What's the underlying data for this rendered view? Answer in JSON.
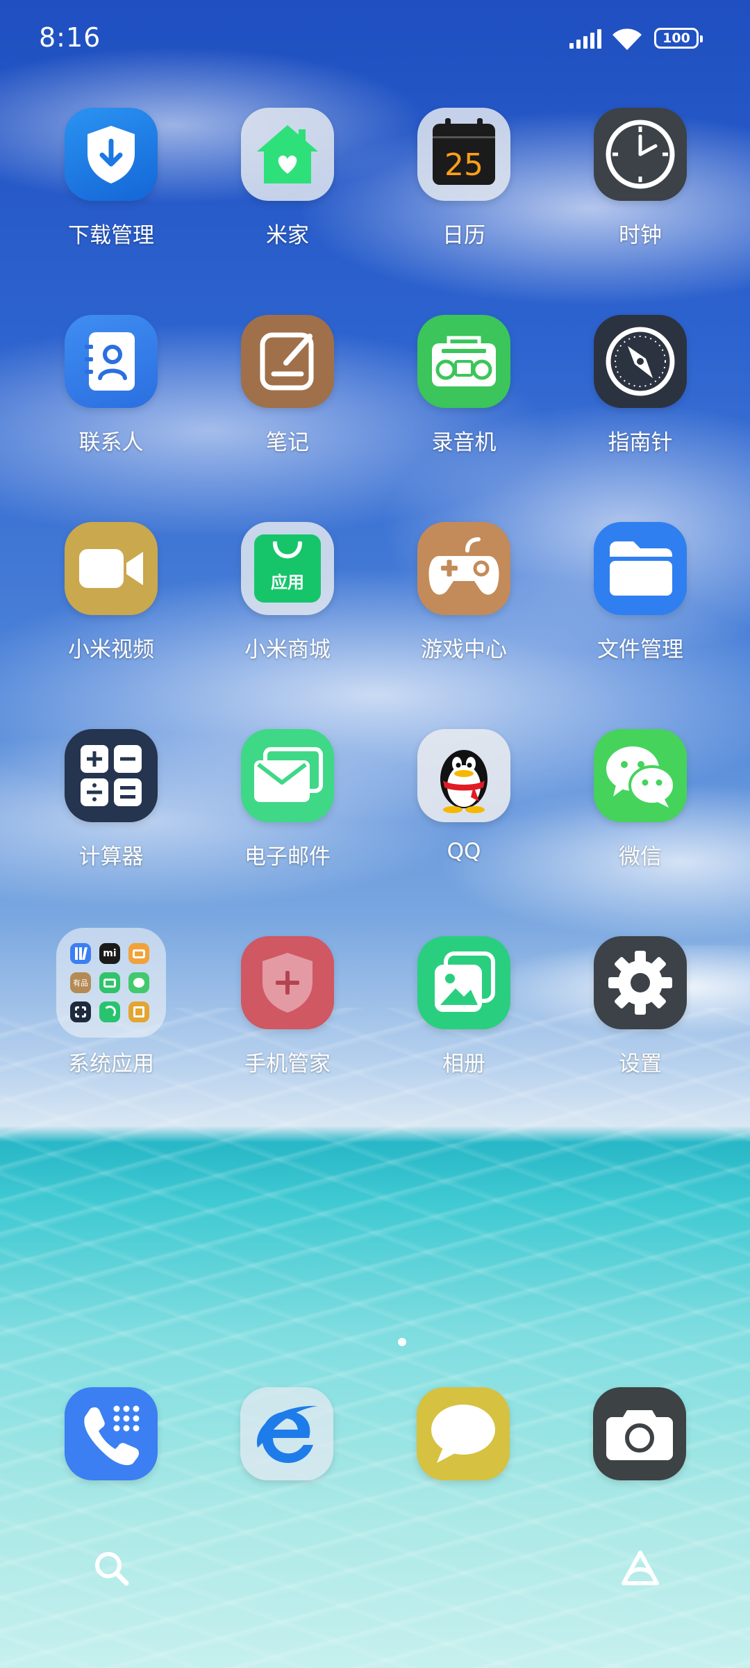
{
  "status_bar": {
    "time": "8:16",
    "battery": "100",
    "icons": [
      "signal-icon",
      "wifi-icon",
      "battery-icon"
    ]
  },
  "apps": {
    "download_manager": "下载管理",
    "mijia": "米家",
    "calendar": "日历",
    "calendar_day": "25",
    "clock": "时钟",
    "contacts": "联系人",
    "notes": "笔记",
    "recorder": "录音机",
    "compass": "指南针",
    "mi_video": "小米视频",
    "mi_store": "小米商城",
    "mi_store_icon_text": "应用",
    "game_center": "游戏中心",
    "file_manager": "文件管理",
    "calculator": "计算器",
    "email": "电子邮件",
    "qq": "QQ",
    "wechat": "微信",
    "system_apps_folder": "系统应用",
    "security": "手机管家",
    "gallery": "相册",
    "settings": "设置"
  },
  "folder_mini_icons": {
    "mi_logo": "mi",
    "youpin": "有品"
  },
  "dock": [
    "phone-icon",
    "browser-icon",
    "messages-icon",
    "camera-icon"
  ],
  "bottom_bar": [
    "search-icon",
    "assistant-icon"
  ],
  "colors": {
    "download_blue": "#1e7fe6",
    "mijia_green": "#2ee07a",
    "notes_brown": "#a0704a",
    "recorder_green": "#3bc55a",
    "video_gold": "#c9a84e",
    "store_green": "#16c56a",
    "game_orange": "#c38b5a",
    "files_blue": "#2f7ff0",
    "calc_dark": "#25344f",
    "mail_green": "#3fd887",
    "wechat_green": "#45d35c",
    "security_red": "#d0525e",
    "gallery_green": "#29cf7f",
    "settings_dark": "#3c4247",
    "phone_blue": "#3b7ff2",
    "message_yellow": "#d6c141",
    "camera_dark": "#3d4245"
  }
}
